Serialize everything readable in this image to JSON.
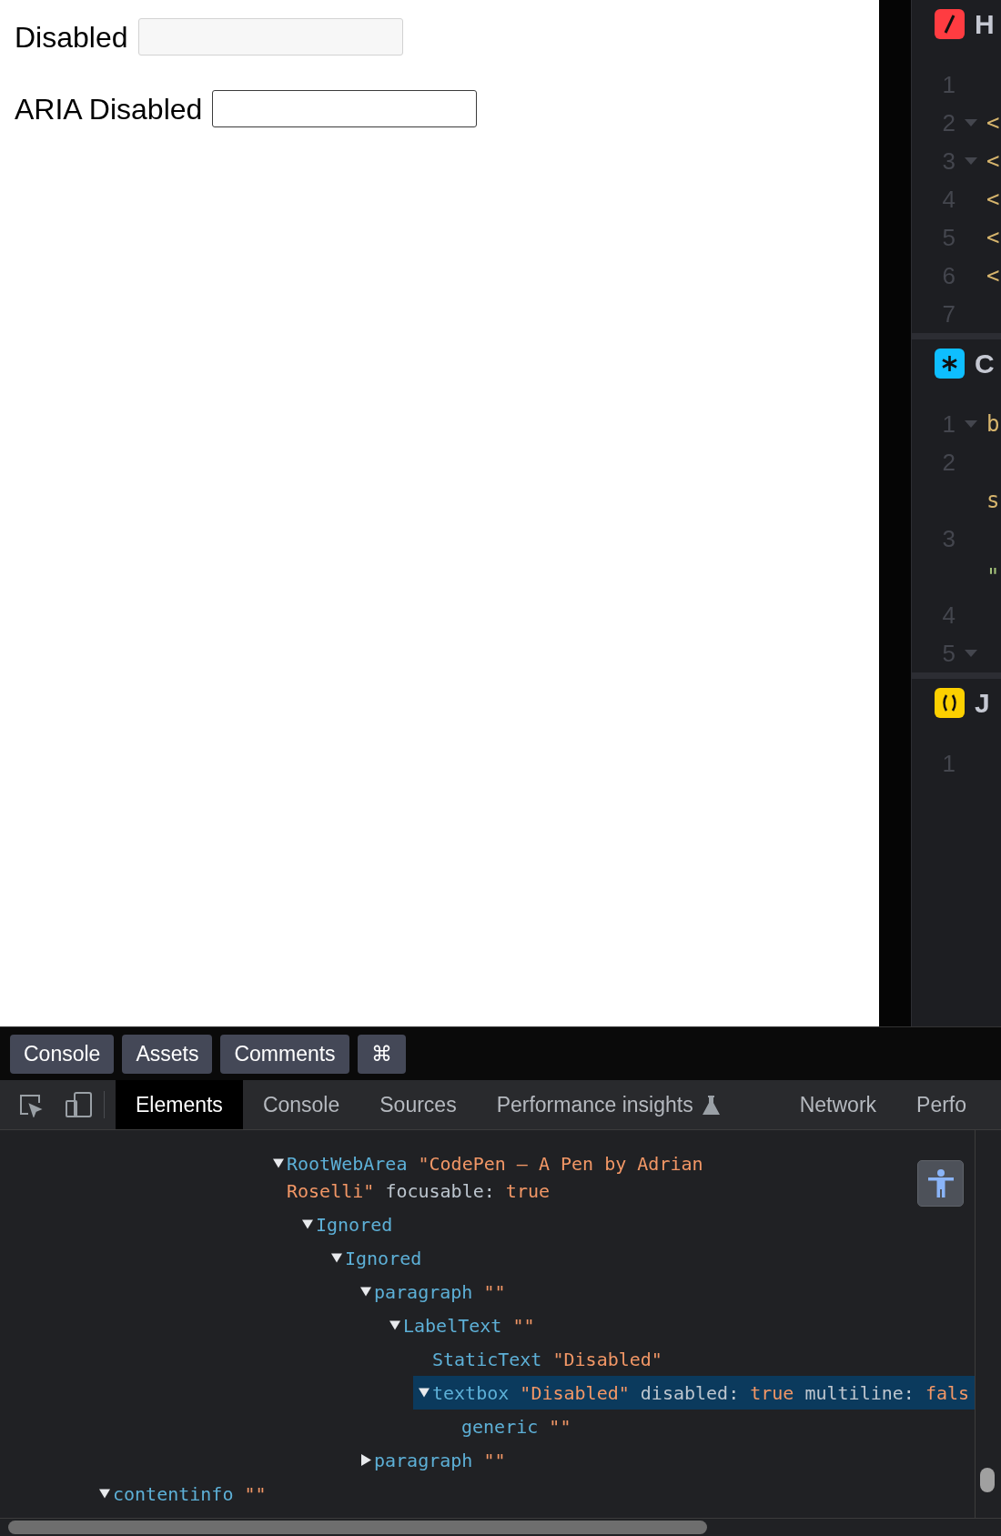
{
  "preview": {
    "fields": [
      {
        "label": "Disabled",
        "disabled": true
      },
      {
        "label": "ARIA Disabled",
        "disabled": false
      }
    ]
  },
  "editors": [
    {
      "kind": "html",
      "title": "H",
      "lines": [
        {
          "number": "1",
          "foldable": false
        },
        {
          "number": "2",
          "foldable": true,
          "code": "<",
          "color": "#d7b56d"
        },
        {
          "number": "3",
          "foldable": true,
          "code": "<",
          "color": "#d7b56d"
        },
        {
          "number": "4",
          "foldable": false,
          "code": "<",
          "color": "#d7b56d"
        },
        {
          "number": "5",
          "foldable": false,
          "code": "<",
          "color": "#d7b56d"
        },
        {
          "number": "6",
          "foldable": false,
          "code": "<",
          "color": "#d7b56d"
        },
        {
          "number": "7",
          "foldable": false
        }
      ]
    },
    {
      "kind": "css",
      "title": "C",
      "lines": [
        {
          "number": "1",
          "foldable": true,
          "code": "b",
          "color": "#d7b56d"
        },
        {
          "number": "2",
          "foldable": false,
          "continuation": "s",
          "color": "#d7b56d"
        },
        {
          "number": "3",
          "foldable": false,
          "continuation": "\"",
          "color": "#a3c17a"
        },
        {
          "number": "4",
          "foldable": false
        },
        {
          "number": "5",
          "foldable": true
        }
      ]
    },
    {
      "kind": "js",
      "title": "J",
      "lines": [
        {
          "number": "1",
          "foldable": false
        }
      ]
    }
  ],
  "drawer_tabs": [
    {
      "label": "Console"
    },
    {
      "label": "Assets"
    },
    {
      "label": "Comments"
    },
    {
      "label": "⌘"
    }
  ],
  "devtools": {
    "tabs": [
      {
        "label": "Elements",
        "selected": true,
        "experimental": false
      },
      {
        "label": "Console",
        "selected": false,
        "experimental": false
      },
      {
        "label": "Sources",
        "selected": false,
        "experimental": false
      },
      {
        "label": "Performance insights",
        "selected": false,
        "experimental": true
      },
      {
        "label": "Network",
        "selected": false,
        "experimental": false
      },
      {
        "label": "Perfo",
        "selected": false,
        "experimental": false
      }
    ],
    "tree": [
      {
        "role": "RootWebArea",
        "name": "\"CodePen – A Pen by Adrian Roselli\"",
        "props": [
          {
            "key": "focusable:",
            "value": "true"
          }
        ],
        "expanded": true,
        "selected": false,
        "children": [
          {
            "role": "Ignored",
            "expanded": true,
            "selected": false,
            "children": [
              {
                "role": "Ignored",
                "expanded": true,
                "selected": false,
                "children": [
                  {
                    "role": "paragraph",
                    "name": "\"\"",
                    "expanded": true,
                    "selected": false,
                    "children": [
                      {
                        "role": "LabelText",
                        "name": "\"\"",
                        "expanded": true,
                        "selected": false,
                        "children": [
                          {
                            "role": "StaticText",
                            "name": "\"Disabled\"",
                            "selected": false
                          },
                          {
                            "role": "textbox",
                            "name": "\"Disabled\"",
                            "props": [
                              {
                                "key": "disabled:",
                                "value": "true"
                              },
                              {
                                "key": "multiline:",
                                "value": "fals"
                              }
                            ],
                            "expanded": true,
                            "selected": true,
                            "children": [
                              {
                                "role": "generic",
                                "name": "\"\"",
                                "selected": false
                              }
                            ]
                          }
                        ]
                      }
                    ]
                  },
                  {
                    "role": "paragraph",
                    "name": "\"\"",
                    "expanded": false,
                    "selected": false
                  }
                ]
              }
            ]
          }
        ]
      },
      {
        "role": "contentinfo",
        "name": "\"\"",
        "expanded": true,
        "selected": false
      }
    ]
  }
}
